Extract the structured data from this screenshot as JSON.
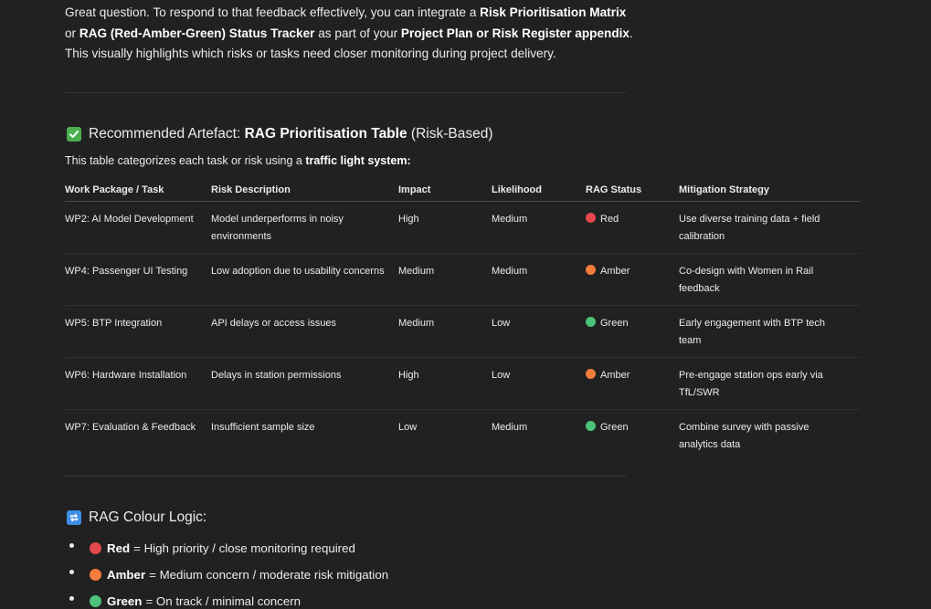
{
  "intro": {
    "p1": "Great question. To respond to that feedback effectively, you can integrate a ",
    "b1": "Risk Prioritisation Matrix",
    "p2": " or ",
    "b2": "RAG (Red-Amber-Green) Status Tracker",
    "p3": " as part of your ",
    "b3": "Project Plan or Risk Register appendix",
    "p4": ". This visually highlights which risks or tasks need closer monitoring during project delivery."
  },
  "artefact": {
    "icon": "check-mark-emoji-icon",
    "prefix": "Recommended Artefact: ",
    "bold": "RAG Prioritisation Table",
    "suffix": " (Risk-Based)",
    "subtitle_pre": "This table categorizes each task or risk using a ",
    "subtitle_bold": "traffic light system:"
  },
  "table": {
    "headers": [
      "Work Package / Task",
      "Risk Description",
      "Impact",
      "Likelihood",
      "RAG Status",
      "Mitigation Strategy"
    ],
    "rows": [
      {
        "task": "WP2: AI Model Development",
        "risk": "Model underperforms in noisy environments",
        "impact": "High",
        "likelihood": "Medium",
        "rag": "Red",
        "rag_color": "#e5484d",
        "mitigation": "Use diverse training data + field calibration"
      },
      {
        "task": "WP4: Passenger UI Testing",
        "risk": "Low adoption due to usability concerns",
        "impact": "Medium",
        "likelihood": "Medium",
        "rag": "Amber",
        "rag_color": "#f47c3c",
        "mitigation": "Co-design with Women in Rail feedback"
      },
      {
        "task": "WP5: BTP Integration",
        "risk": "API delays or access issues",
        "impact": "Medium",
        "likelihood": "Low",
        "rag": "Green",
        "rag_color": "#4cc37a",
        "mitigation": "Early engagement with BTP tech team"
      },
      {
        "task": "WP6: Hardware Installation",
        "risk": "Delays in station permissions",
        "impact": "High",
        "likelihood": "Low",
        "rag": "Amber",
        "rag_color": "#f47c3c",
        "mitigation": "Pre-engage station ops early via TfL/SWR"
      },
      {
        "task": "WP7: Evaluation & Feedback",
        "risk": "Insufficient sample size",
        "impact": "Low",
        "likelihood": "Medium",
        "rag": "Green",
        "rag_color": "#4cc37a",
        "mitigation": "Combine survey with passive analytics data"
      }
    ]
  },
  "logic": {
    "icon": "repeat-arrows-emoji-icon",
    "title": "RAG Colour Logic:",
    "items": [
      {
        "label": "Red",
        "text": "= High priority / close monitoring required",
        "color": "#e5484d"
      },
      {
        "label": "Amber",
        "text": "= Medium concern / moderate risk mitigation",
        "color": "#f47c3c"
      },
      {
        "label": "Green",
        "text": "= On track / minimal concern",
        "color": "#4cc37a"
      }
    ]
  }
}
